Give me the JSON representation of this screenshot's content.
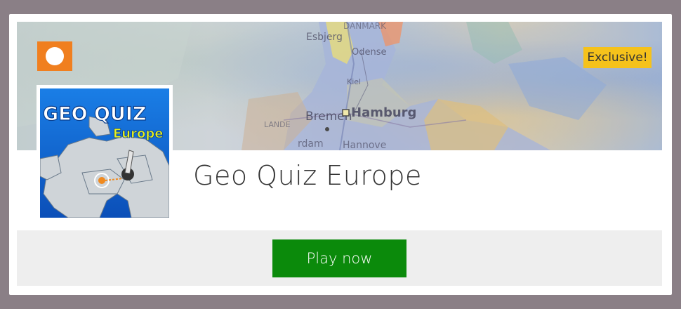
{
  "game": {
    "title": "Geo Quiz Europe",
    "badge": "Exclusive!",
    "play_label": "Play now"
  },
  "thumbnail": {
    "line1": "GEO QUIZ",
    "line2": "Europe"
  },
  "banner_map_labels": {
    "hamburg": "Hamburg",
    "bremen": "Bremen",
    "kiel": "Kiel",
    "odense": "Odense",
    "esbjerg": "Esbjerg",
    "hannover": "Hannove",
    "dam": "rdam",
    "lande": "LANDE",
    "dnmark": "DANMARK"
  },
  "colors": {
    "accent_orange": "#f07f1f",
    "badge_yellow": "#f5c21b",
    "play_green": "#0b8a0b",
    "frame": "#8a7f86"
  },
  "icons": {
    "back": "chevron-left-icon"
  }
}
